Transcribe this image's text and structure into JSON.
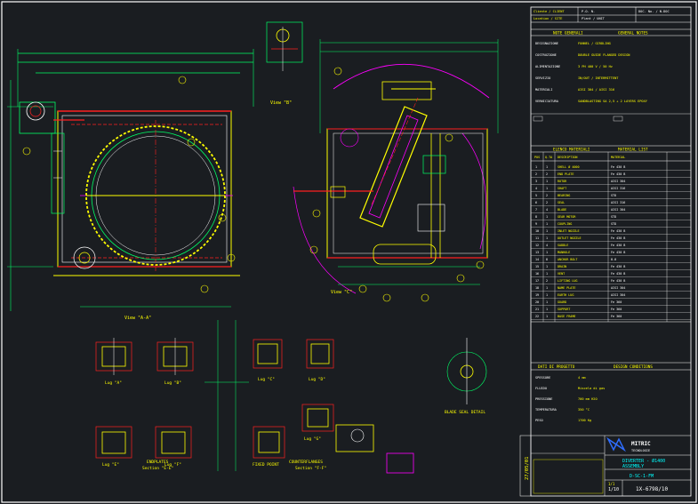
{
  "colors": {
    "background": "#1a1d21",
    "frame": "#ffffff",
    "yellow": "#ffff00",
    "green": "#00ff66",
    "magenta": "#ff00ff",
    "red": "#ff2020",
    "cyan": "#00ffff",
    "blue": "#2f6dff"
  },
  "title_strip": {
    "client_label": "Cliente / CLIENT",
    "po_label": "P.O. N.",
    "doc_label": "DOC. No. / N.DOC",
    "location_label": "Location / SITE",
    "plant_label": "Plant / UNIT"
  },
  "notes_panel": {
    "title_it": "NOTE GENERALI",
    "title_en": "GENERAL NOTES",
    "rows": [
      {
        "label": "DESIGNAZIONE",
        "value": "FUNNEL / GIRDLING"
      },
      {
        "label": "COSTRUZIONE",
        "value": "DOUBLE GUIDE FLANGED DESIGN"
      },
      {
        "label": "ALIMENTAZIONE",
        "value": "3 PH 400 V / 50 Hz"
      },
      {
        "label": "SERVIZIO",
        "value": "IN/OUT / INTERMITTENT"
      },
      {
        "label": "MATERIALI",
        "value": "AISI 304 / AISI 316"
      },
      {
        "label": "VERNICIATURA",
        "value": "SANDBLASTING SA 2,5 + 2 LAYERS EPOXY"
      }
    ]
  },
  "materials_panel": {
    "title_it": "ELENCO MATERIALI",
    "title_en": "MATERIAL LIST",
    "header": [
      "POS",
      "Q.TA",
      "DESCRIPTION",
      "MATERIAL"
    ],
    "rows": [
      {
        "pos": "1",
        "qty": "1",
        "desc": "SHELL Ø 4000",
        "mat": "Fe 430 B"
      },
      {
        "pos": "2",
        "qty": "2",
        "desc": "END PLATE",
        "mat": "Fe 430 B"
      },
      {
        "pos": "3",
        "qty": "1",
        "desc": "ROTOR",
        "mat": "AISI 304"
      },
      {
        "pos": "4",
        "qty": "1",
        "desc": "SHAFT",
        "mat": "AISI 316"
      },
      {
        "pos": "5",
        "qty": "2",
        "desc": "BEARING",
        "mat": "STD"
      },
      {
        "pos": "6",
        "qty": "2",
        "desc": "SEAL",
        "mat": "AISI 316"
      },
      {
        "pos": "7",
        "qty": "4",
        "desc": "BLADE",
        "mat": "AISI 304"
      },
      {
        "pos": "8",
        "qty": "1",
        "desc": "GEAR MOTOR",
        "mat": "STD"
      },
      {
        "pos": "9",
        "qty": "1",
        "desc": "COUPLING",
        "mat": "STD"
      },
      {
        "pos": "10",
        "qty": "1",
        "desc": "INLET NOZZLE",
        "mat": "Fe 430 B"
      },
      {
        "pos": "11",
        "qty": "1",
        "desc": "OUTLET NOZZLE",
        "mat": "Fe 430 B"
      },
      {
        "pos": "12",
        "qty": "4",
        "desc": "SADDLE",
        "mat": "Fe 430 B"
      },
      {
        "pos": "13",
        "qty": "1",
        "desc": "MANHOLE",
        "mat": "Fe 430 B"
      },
      {
        "pos": "14",
        "qty": "8",
        "desc": "ANCHOR BOLT",
        "mat": "8.8"
      },
      {
        "pos": "15",
        "qty": "1",
        "desc": "DRAIN",
        "mat": "Fe 430 B"
      },
      {
        "pos": "16",
        "qty": "1",
        "desc": "VENT",
        "mat": "Fe 430 B"
      },
      {
        "pos": "17",
        "qty": "2",
        "desc": "LIFTING LUG",
        "mat": "Fe 430 B"
      },
      {
        "pos": "18",
        "qty": "1",
        "desc": "NAME PLATE",
        "mat": "AISI 304"
      },
      {
        "pos": "19",
        "qty": "1",
        "desc": "EARTH LUG",
        "mat": "AISI 304"
      },
      {
        "pos": "20",
        "qty": "1",
        "desc": "GUARD",
        "mat": "Fe 360"
      },
      {
        "pos": "21",
        "qty": "1",
        "desc": "SUPPORT",
        "mat": "Fe 360"
      },
      {
        "pos": "22",
        "qty": "1",
        "desc": "BASE FRAME",
        "mat": "Fe 360"
      }
    ]
  },
  "design_panel": {
    "title_it": "DATI DI PROGETTO",
    "title_en": "DESIGN CONDITIONS",
    "rows": [
      {
        "label": "SPESSORE",
        "value": "4 mm"
      },
      {
        "label": "FLUIDO",
        "value": "Miscela di gas"
      },
      {
        "label": "PRESSIONE",
        "value": "700 mm H2O"
      },
      {
        "label": "TEMPERATURA",
        "value": "350 °C"
      },
      {
        "label": "PESO",
        "value": "1700 Kg"
      }
    ]
  },
  "title_block": {
    "company": "MITRIC",
    "company_sub": "TECNOLOGIE",
    "drawing_title_1": "DIVERTER - Ø1400",
    "drawing_title_2": "ASSEMBLY",
    "drawing_code": "D-SC-1-FM",
    "scale": "1/10",
    "drawing_number": "1X-6798/10",
    "side_code": "27/05/01",
    "sheet": "1/1"
  },
  "view_labels": {
    "view_aa": "View \"A-A\"",
    "view_b": "View \"B\"",
    "view_c": "View \"C\"",
    "section_ee": "Section \"E-E\"",
    "section_ff": "Section \"F-F\"",
    "blade_seal": "BLADE SEAL DETAIL",
    "counterflange": "COUNTERFLANGES",
    "fixed_point": "FIXED POINT",
    "endplates": "ENDPLATES",
    "lug_a": "Lug \"A\"",
    "lug_b": "Lug \"B\"",
    "lug_c": "Lug \"C\"",
    "lug_d": "Lug \"D\"",
    "lug_e": "Lug \"E\"",
    "lug_f": "Lug \"F\"",
    "lug_g": "Lug \"G\""
  }
}
